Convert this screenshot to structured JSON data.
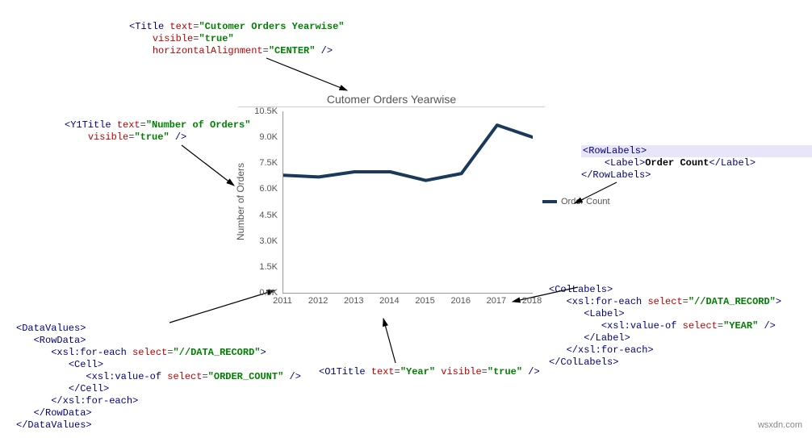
{
  "watermark": "wsxdn.com",
  "chart_data": {
    "type": "line",
    "title": "Cutomer Orders Yearwise",
    "xlabel": "Year",
    "ylabel": "Number of Orders",
    "categories": [
      "2011",
      "2012",
      "2013",
      "2014",
      "2015",
      "2016",
      "2017",
      "2018"
    ],
    "values": [
      6800,
      6700,
      7000,
      7000,
      6500,
      6900,
      9700,
      9000
    ],
    "yticks": [
      "0.0K",
      "1.5K",
      "3.0K",
      "4.5K",
      "6.0K",
      "7.5K",
      "9.0K",
      "10.5K"
    ],
    "ylim": [
      0,
      10500
    ],
    "legend": {
      "label": "Order Count"
    }
  },
  "snippets": {
    "title": {
      "tag_open": "<Title",
      "a1": "text",
      "v1": "\"Cutomer Orders Yearwise\"",
      "a2": "visible",
      "v2": "\"true\"",
      "a3": "horizontalAlignment",
      "v3": "\"CENTER\"",
      "close": "/>"
    },
    "y1title": {
      "tag_open": "<Y1Title",
      "a1": "text",
      "v1": "\"Number of Orders\"",
      "a2": "visible",
      "v2": "\"true\"",
      "close": "/>"
    },
    "o1title": {
      "tag_open": "<O1Title",
      "a1": "text",
      "v1": "\"Year\"",
      "a2": "visible",
      "v2": "\"true\"",
      "close": "/>"
    },
    "rowlabels": {
      "open": "<RowLabels>",
      "label_open": "<Label>",
      "label_text": "Order Count",
      "label_close": "</Label>",
      "close": "</RowLabels>"
    },
    "collabels": {
      "open": "<ColLabels>",
      "fe_open": "<xsl:for-each",
      "fe_attr": "select",
      "fe_val": "\"//DATA_RECORD\"",
      "fe_close": ">",
      "label_open": "<Label>",
      "vo_open": "<xsl:value-of",
      "vo_attr": "select",
      "vo_val": "\"YEAR\"",
      "vo_close": "/>",
      "label_close": "</Label>",
      "fe_end": "</xsl:for-each>",
      "close": "</ColLabels>"
    },
    "datavalues": {
      "dv_open": "<DataValues>",
      "rd_open": "<RowData>",
      "fe_open": "<xsl:for-each",
      "fe_attr": "select",
      "fe_val": "\"//DATA_RECORD\"",
      "fe_close": ">",
      "cell_open": "<Cell>",
      "vo_open": "<xsl:value-of",
      "vo_attr": "select",
      "vo_val": "\"ORDER_COUNT\"",
      "vo_close": "/>",
      "cell_close": "</Cell>",
      "fe_end": "</xsl:for-each>",
      "rd_close": "</RowData>",
      "dv_close": "</DataValues>"
    }
  }
}
